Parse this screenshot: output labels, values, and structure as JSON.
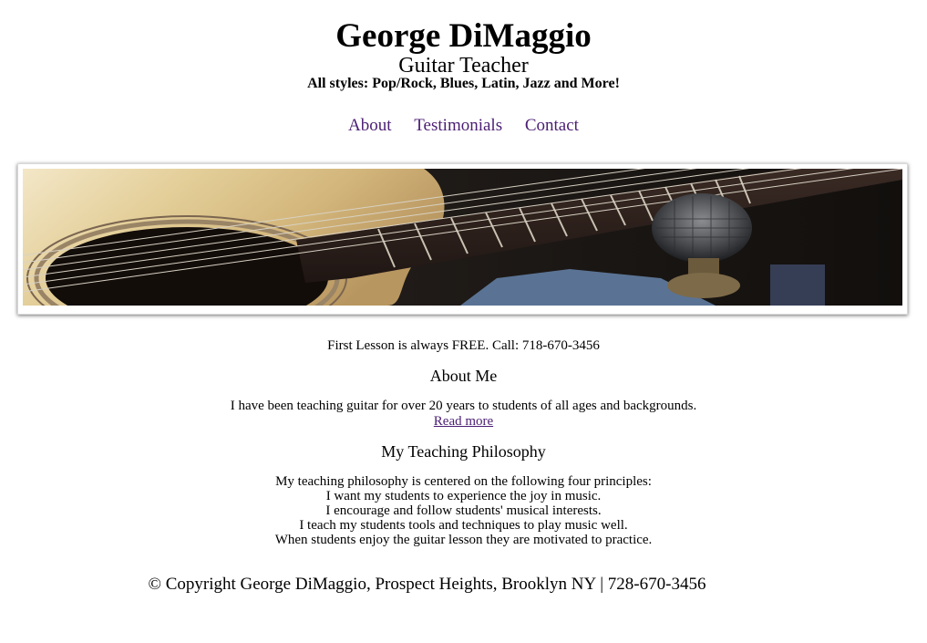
{
  "header": {
    "title": "George DiMaggio",
    "subtitle": "Guitar Teacher",
    "tagline": "All styles: Pop/Rock, Blues, Latin, Jazz and More!"
  },
  "nav": {
    "items": [
      {
        "label": "About"
      },
      {
        "label": "Testimonials"
      },
      {
        "label": "Contact"
      }
    ],
    "link_color": "#4b1e73"
  },
  "banner": {
    "subject": "acoustic guitar and microphone"
  },
  "main": {
    "promo": "First Lesson is always FREE. Call: 718-670-3456",
    "about_heading": "About Me",
    "about_text": "I have been teaching guitar for over 20 years to students of all ages and backgrounds.",
    "read_more": "Read more",
    "philosophy_heading": "My Teaching Philosophy",
    "philosophy_lines": [
      "My teaching philosophy is centered on the following four principles:",
      "I want my students to experience the joy in music.",
      "I encourage and follow students' musical interests.",
      "I teach my students tools and techniques to play music well.",
      "When students enjoy the guitar lesson they are motivated to practice."
    ]
  },
  "footer": {
    "copyright": "© Copyright George DiMaggio, Prospect Heights, Brooklyn NY | 728-670-3456"
  }
}
